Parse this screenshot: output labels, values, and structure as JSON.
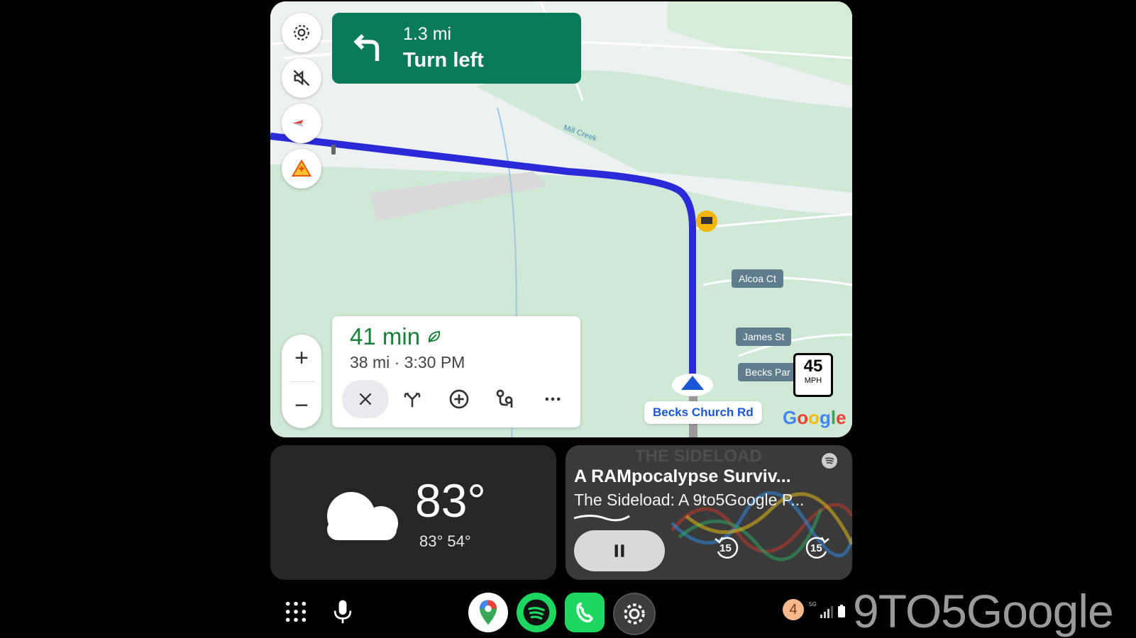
{
  "navigation": {
    "distance": "1.3 mi",
    "instruction": "Turn left"
  },
  "trip": {
    "time": "41 min",
    "details": "38 mi · 3:30 PM"
  },
  "map": {
    "labels": {
      "creek": "Mill Creek",
      "road1": "Alcoa Ct",
      "road2": "James St",
      "road3": "Becks Par",
      "current_road": "Becks Church Rd"
    },
    "speed_limit": {
      "value": "45",
      "unit": "MPH"
    },
    "logo": "Google"
  },
  "weather": {
    "temp": "83°",
    "high_low": "83°  54°"
  },
  "media": {
    "title": "A RAMpocalypse Surviv...",
    "subtitle": "The Sideload: A 9to5Google P...",
    "bg_text": "THE SIDELOAD",
    "skip_back": "15",
    "skip_fwd": "15"
  },
  "status": {
    "notification_count": "4",
    "signal": "5G"
  },
  "watermark": "9TO5Google",
  "colors": {
    "turn_card": "#0b7a5a",
    "route": "#2a2ad8",
    "eta_green": "#188038"
  }
}
